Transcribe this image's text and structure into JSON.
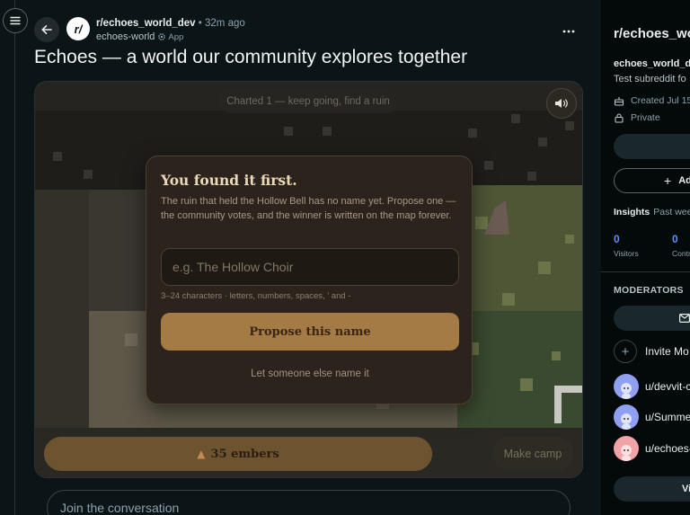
{
  "post": {
    "subreddit": "r/echoes_world_dev",
    "time": "• 32m ago",
    "author": "echoes-world",
    "app_label": "App",
    "title": "Echoes — a world our community explores together"
  },
  "game": {
    "status": "Charted 1 — keep going, find a ruin",
    "dialog": {
      "title": "You found it first.",
      "body": "The ruin that held the Hollow Bell has no name yet. Propose one — the community votes, and the winner is written on the map forever.",
      "input_placeholder": "e.g. The Hollow Choir",
      "input_value": "",
      "hint": "3–24 characters · letters, numbers, spaces, ' and -",
      "propose_label": "Propose this name",
      "skip_label": "Let someone else name it"
    },
    "embers_label": "35 embers",
    "camp_label": "Make camp"
  },
  "comment": {
    "placeholder": "Join the conversation"
  },
  "sidebar": {
    "title": "r/echoes_wo",
    "name": "echoes_world_d",
    "description": "Test subreddit fo",
    "created": "Created Jul 15",
    "privacy": "Private",
    "add_label": "Ad",
    "insights_label": "Insights",
    "insights_period": "Past wee",
    "stats": [
      {
        "value": "0",
        "label": "Visitors"
      },
      {
        "value": "0",
        "label": "Contr"
      }
    ],
    "moderators_label": "MODERATORS",
    "invite_label": "Invite Mo",
    "moderators": [
      {
        "name": "u/devvit-c",
        "color": "#8f9ff2"
      },
      {
        "name": "u/Summe",
        "color": "#8f9ff2"
      },
      {
        "name": "u/echoes-",
        "color": "#f2a3a8"
      }
    ],
    "view_label": "Vi"
  },
  "colors": {
    "accent_button": "#a47a45",
    "dialog_bg": "#2b231c",
    "stat_blue": "#648efc"
  }
}
